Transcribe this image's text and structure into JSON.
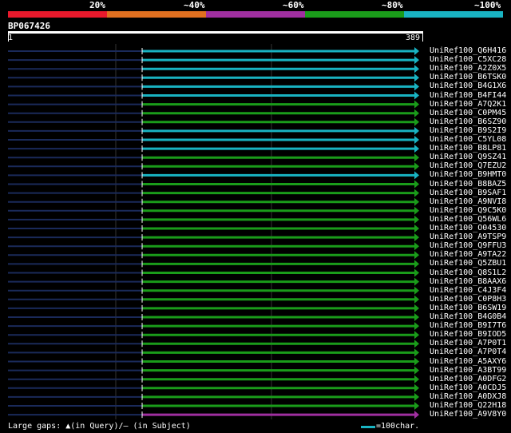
{
  "legend": {
    "labels": [
      "20%",
      "~40%",
      "~60%",
      "~80%",
      "~100%"
    ],
    "colors": [
      "#e8192c",
      "#e07020",
      "#a02fa0",
      "#1a9c1a",
      "#19b3c2"
    ]
  },
  "query": {
    "id": "BP067426",
    "start": "1",
    "end": "389"
  },
  "hits": [
    {
      "label": "UniRef100_Q6H416",
      "color": "#19b3c2"
    },
    {
      "label": "UniRef100_C5XC28",
      "color": "#19b3c2"
    },
    {
      "label": "UniRef100_A2Z0X5",
      "color": "#19b3c2"
    },
    {
      "label": "UniRef100_B6TSK0",
      "color": "#19b3c2"
    },
    {
      "label": "UniRef100_B4G1X6",
      "color": "#19b3c2"
    },
    {
      "label": "UniRef100_B4FI44",
      "color": "#19b3c2"
    },
    {
      "label": "UniRef100_A7Q2K1",
      "color": "#1a9c1a"
    },
    {
      "label": "UniRef100_C0PM45",
      "color": "#1a9c1a"
    },
    {
      "label": "UniRef100_B6SZ90",
      "color": "#1a9c1a"
    },
    {
      "label": "UniRef100_B9S2I9",
      "color": "#19b3c2"
    },
    {
      "label": "UniRef100_C5YL08",
      "color": "#19b3c2"
    },
    {
      "label": "UniRef100_B8LP81",
      "color": "#19b3c2"
    },
    {
      "label": "UniRef100_Q9SZ41",
      "color": "#1a9c1a"
    },
    {
      "label": "UniRef100_Q7EZU2",
      "color": "#1a9c1a"
    },
    {
      "label": "UniRef100_B9HMT0",
      "color": "#19b3c2"
    },
    {
      "label": "UniRef100_B8BAZ5",
      "color": "#1a9c1a"
    },
    {
      "label": "UniRef100_B9SAF1",
      "color": "#1a9c1a"
    },
    {
      "label": "UniRef100_A9NVI8",
      "color": "#1a9c1a"
    },
    {
      "label": "UniRef100_Q9C5K0",
      "color": "#1a9c1a"
    },
    {
      "label": "UniRef100_Q56WL6",
      "color": "#1a9c1a"
    },
    {
      "label": "UniRef100_O04530",
      "color": "#1a9c1a"
    },
    {
      "label": "UniRef100_A9TSP9",
      "color": "#1a9c1a"
    },
    {
      "label": "UniRef100_Q9FFU3",
      "color": "#1a9c1a"
    },
    {
      "label": "UniRef100_A9TA22",
      "color": "#1a9c1a"
    },
    {
      "label": "UniRef100_Q5ZBU1",
      "color": "#1a9c1a"
    },
    {
      "label": "UniRef100_Q8S1L2",
      "color": "#1a9c1a"
    },
    {
      "label": "UniRef100_B8AAX6",
      "color": "#1a9c1a"
    },
    {
      "label": "UniRef100_C4J3F4",
      "color": "#1a9c1a"
    },
    {
      "label": "UniRef100_C0P8H3",
      "color": "#1a9c1a"
    },
    {
      "label": "UniRef100_B6SW19",
      "color": "#1a9c1a"
    },
    {
      "label": "UniRef100_B4G0B4",
      "color": "#1a9c1a"
    },
    {
      "label": "UniRef100_B9I7T6",
      "color": "#1a9c1a"
    },
    {
      "label": "UniRef100_B9IOD5",
      "color": "#1a9c1a"
    },
    {
      "label": "UniRef100_A7P0T1",
      "color": "#1a9c1a"
    },
    {
      "label": "UniRef100_A7P0T4",
      "color": "#1a9c1a"
    },
    {
      "label": "UniRef100_A5AXY6",
      "color": "#1a9c1a"
    },
    {
      "label": "UniRef100_A3BT99",
      "color": "#1a9c1a"
    },
    {
      "label": "UniRef100_A0DFG2",
      "color": "#1a9c1a"
    },
    {
      "label": "UniRef100_A0CDJ5",
      "color": "#1a9c1a"
    },
    {
      "label": "UniRef100_A0DXJ8",
      "color": "#1a9c1a"
    },
    {
      "label": "UniRef100_Q22H18",
      "color": "#1a9c1a"
    },
    {
      "label": "UniRef100_A9V8Y0",
      "color": "#a02fa0"
    }
  ],
  "footer": {
    "left": "Large gaps: ▲(in Query)/— (in Subject)",
    "scale": "=100char."
  }
}
